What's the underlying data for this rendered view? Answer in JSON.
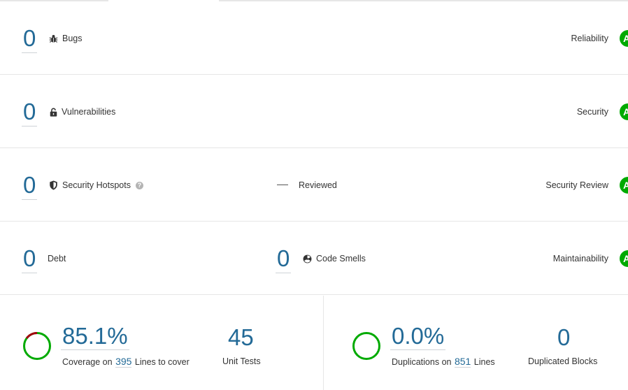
{
  "colors": {
    "link_blue": "#236a97",
    "rating_green": "#00aa00",
    "coverage_red": "#a4030f",
    "text": "#333333"
  },
  "rows": {
    "bugs": {
      "value": "0",
      "label": "Bugs",
      "icon": "bug-icon",
      "rating_label": "Reliability",
      "rating": "A"
    },
    "vulnerabilities": {
      "value": "0",
      "label": "Vulnerabilities",
      "icon": "lock-icon",
      "rating_label": "Security",
      "rating": "A"
    },
    "hotspots": {
      "value": "0",
      "label": "Security Hotspots",
      "icon": "shield-icon",
      "help_icon": "?",
      "reviewed_value": "—",
      "reviewed_label": "Reviewed",
      "rating_label": "Security Review",
      "rating": "A"
    },
    "maintainability": {
      "debt_value": "0",
      "debt_label": "Debt",
      "smells_value": "0",
      "smells_label": "Code Smells",
      "icon": "code-smell-icon",
      "rating_label": "Maintainability",
      "rating": "A"
    }
  },
  "coverage": {
    "percent": "85.1%",
    "percent_fraction": 0.851,
    "label_prefix": "Coverage on",
    "lines": "395",
    "label_suffix": "Lines to cover",
    "unit_tests_value": "45",
    "unit_tests_label": "Unit Tests"
  },
  "duplications": {
    "percent": "0.0%",
    "percent_fraction": 0.0,
    "label_prefix": "Duplications on",
    "lines": "851",
    "label_suffix": "Lines",
    "blocks_value": "0",
    "blocks_label": "Duplicated Blocks"
  }
}
